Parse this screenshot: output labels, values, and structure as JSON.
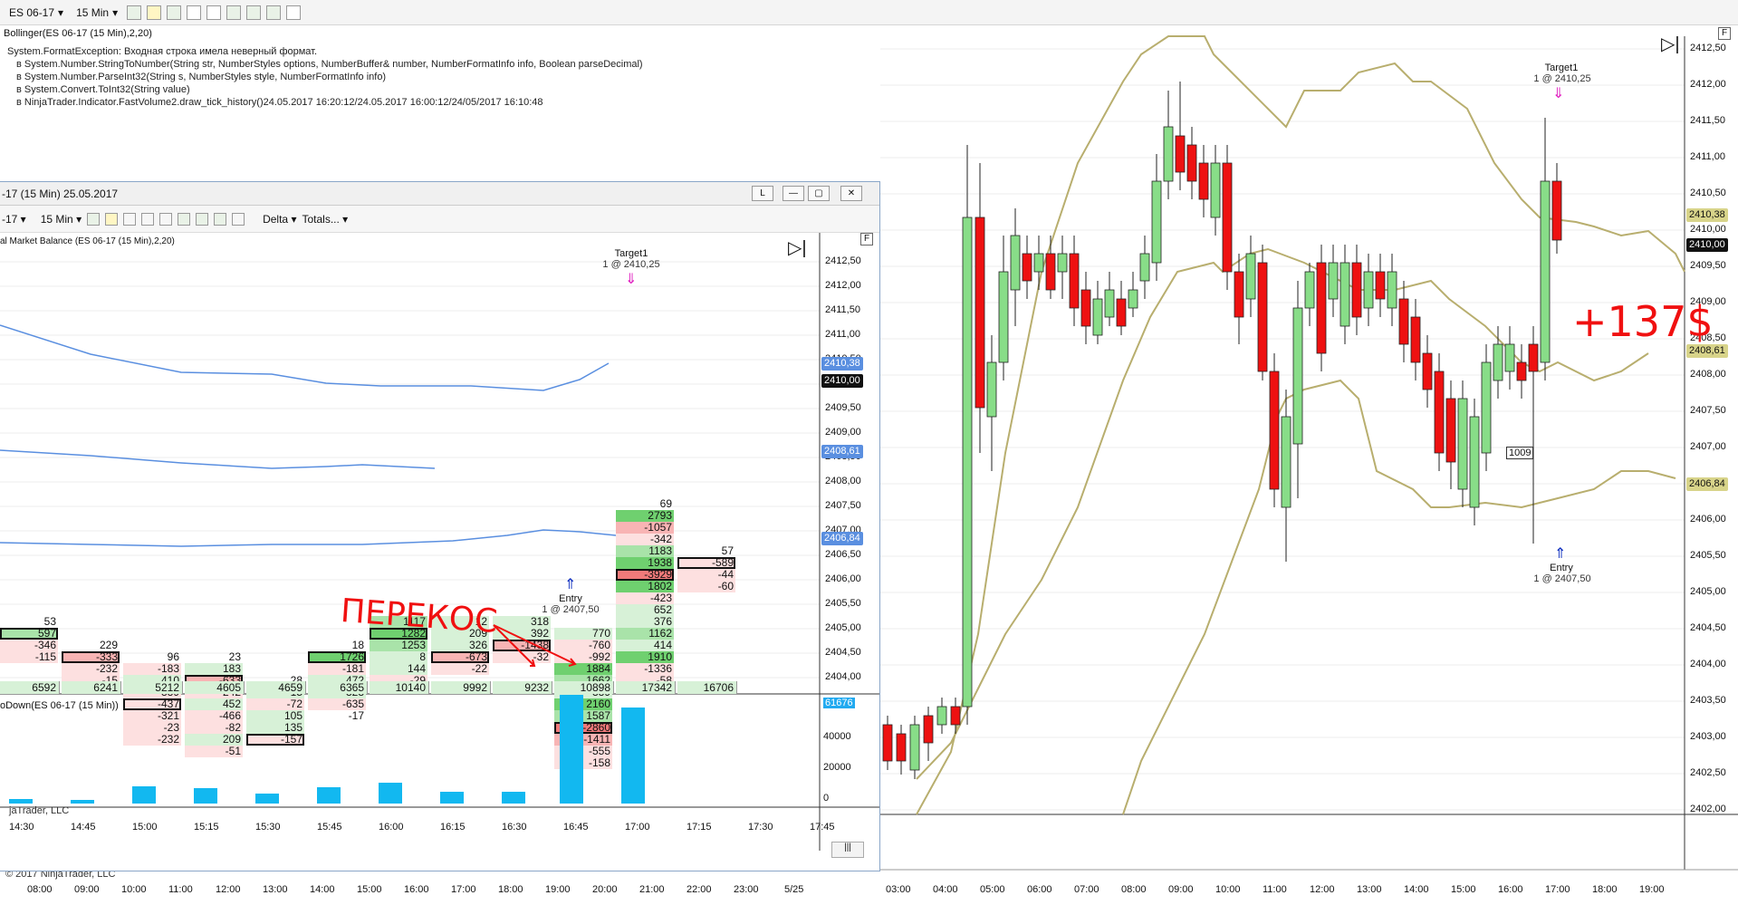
{
  "toolbar": {
    "instrument": "ES 06-17",
    "interval": "15 Min"
  },
  "main": {
    "indicator_label": "Bollinger(ES 06-17 (15 Min),2,20)",
    "error_lines": [
      "System.FormatException: Входная строка имела неверный формат.",
      "в System.Number.StringToNumber(String str, NumberStyles options, NumberBuffer& number, NumberFormatInfo info, Boolean parseDecimal)",
      "в System.Number.ParseInt32(String s, NumberStyles style, NumberFormatInfo info)",
      "в System.Convert.ToInt32(String value)",
      "в NinjaTrader.Indicator.FastVolume2.draw_tick_history()24.05.2017 16:20:12/24.05.2017 16:00:12/24/05/2017 16:10:48"
    ],
    "y_axis": [
      "2412,50",
      "2412,00",
      "2411,50",
      "2411,00",
      "2410,50",
      "2410,00",
      "2409,50",
      "2409,00",
      "2408,50",
      "2408,00",
      "2407,50",
      "2407,00",
      "2406,50",
      "2406,00",
      "2405,50",
      "2405,00",
      "2404,50",
      "2404,00",
      "2403,50",
      "2403,00",
      "2402,50",
      "2402,00"
    ],
    "price_tags": [
      {
        "text": "2410,38",
        "bg": "#d8d48a"
      },
      {
        "text": "2410,00",
        "bg": "#111111",
        "fg": "#ffffff"
      },
      {
        "text": "2408,61",
        "bg": "#d8d48a"
      },
      {
        "text": "2406,84",
        "bg": "#d8d48a"
      }
    ],
    "x_axis": [
      "08:00",
      "09:00",
      "10:00",
      "11:00",
      "12:00",
      "13:00",
      "14:00",
      "15:00",
      "16:00",
      "17:00",
      "18:00",
      "19:00",
      "20:00",
      "21:00",
      "22:00",
      "23:00",
      "5/25",
      "",
      "03:00",
      "04:00",
      "05:00",
      "06:00",
      "07:00",
      "08:00",
      "09:00",
      "10:00",
      "11:00",
      "12:00",
      "13:00",
      "14:00",
      "15:00",
      "16:00",
      "17:00",
      "18:00",
      "19:00"
    ],
    "target_label": "Target1",
    "target_price": "1 @ 2410,25",
    "entry_label": "Entry",
    "entry_price": "1 @ 2407,50",
    "box_value": "1009",
    "copyright": "© 2017 NinjaTrader, LLC",
    "f_button": "F"
  },
  "window": {
    "title": "-17 (15 Min)  25.05.2017",
    "btn_l": "L",
    "instrument": "-17",
    "interval": "15 Min",
    "delta": "Delta",
    "totals": "Totals...",
    "indicator_label": "al Market Balance  (ES 06-17 (15 Min),2,20)",
    "y_axis": [
      "2412,50",
      "2412,00",
      "2411,50",
      "2411,00",
      "2410,50",
      "2410,00",
      "2409,50",
      "2409,00",
      "2408,50",
      "2408,00",
      "2407,50",
      "2407,00",
      "2406,50",
      "2406,00",
      "2405,50",
      "2405,00",
      "2404,50",
      "2404,00"
    ],
    "price_tags": [
      "2410,38",
      "2410,00",
      "2408,61",
      "2406,84"
    ],
    "target_label": "Target1",
    "target_price": "1 @ 2410,25",
    "entry_label": "Entry",
    "entry_price": "1 @ 2407,50",
    "totals_row": [
      "6592",
      "6241",
      "5212",
      "4605",
      "4659",
      "6365",
      "10140",
      "9992",
      "9232",
      "10898",
      "17342",
      "16706"
    ],
    "lower_label": "oDown(ES 06-17 (15 Min))",
    "lower_axis": [
      "61676",
      "40000",
      "20000",
      "0"
    ],
    "lower_bars": [
      0.04,
      0.03,
      0.16,
      0.14,
      0.09,
      0.15,
      0.19,
      0.11,
      0.11,
      1.0,
      0.88
    ],
    "x_axis": [
      "14:30",
      "14:45",
      "15:00",
      "15:15",
      "15:30",
      "15:45",
      "16:00",
      "16:15",
      "16:30",
      "16:45",
      "17:00",
      "17:15",
      "17:30",
      "17:45"
    ],
    "copyright": "jaTrader, LLC",
    "f_button": "F"
  },
  "annotations": {
    "skew": "ПЕРЕКОС",
    "profit": "+137$"
  }
}
